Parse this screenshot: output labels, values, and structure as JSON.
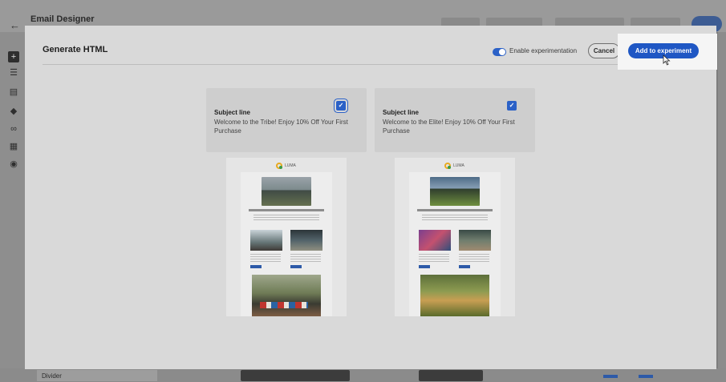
{
  "app": {
    "back_icon": "←",
    "title": "Email Designer",
    "colors": {
      "accent": "#1f57c4",
      "toggle": "#2b61c7"
    }
  },
  "modal": {
    "title": "Generate HTML",
    "toggle_label": "Enable experimentation",
    "toggle_on": true,
    "cancel_label": "Cancel",
    "add_label": "Add to experiment"
  },
  "variants": [
    {
      "subject_label": "Subject line",
      "subject_text": "Welcome to the Tribe! Enjoy 10% Off Your First Purchase",
      "checked": true,
      "brand": "LUMA"
    },
    {
      "subject_label": "Subject line",
      "subject_text": "Welcome to the Elite! Enjoy 10% Off Your First Purchase",
      "checked": true,
      "brand": "LUMA"
    }
  ],
  "bottom_bar": {
    "divider_label": "Divider"
  }
}
